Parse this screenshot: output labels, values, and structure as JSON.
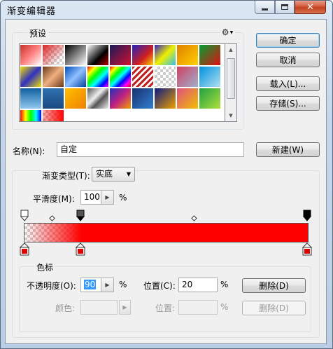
{
  "window": {
    "title": "渐变编辑器"
  },
  "titlebar_icons": {
    "minimize": "minimize-icon",
    "maximize": "maximize-icon",
    "close": "close-icon"
  },
  "buttons": {
    "ok": "确定",
    "cancel": "取消",
    "load": "载入(L)...",
    "save": "存储(S)...",
    "new": "新建(W)",
    "delete_opacity": "删除(D)",
    "delete_color": "删除(D)"
  },
  "presets": {
    "label": "预设",
    "menu_icon": "gear-icon"
  },
  "name": {
    "label": "名称(N):",
    "value": "自定"
  },
  "gradient_type": {
    "label": "渐变类型(T):",
    "value": "实底"
  },
  "smoothness": {
    "label": "平滑度(M):",
    "value": "100",
    "unit": "%"
  },
  "color_stops": {
    "group_label": "色标",
    "opacity_label": "不透明度(O):",
    "opacity_value": "90",
    "opacity_unit": "%",
    "location_label": "位置(C):",
    "location_value": "20",
    "location_unit": "%",
    "color_label": "颜色:",
    "color_location_label": "位置:",
    "color_location_unit": "%"
  },
  "gradient": {
    "color": "#ff0000",
    "opacity_stops": [
      0,
      20,
      100
    ],
    "color_stops": [
      0,
      20,
      100
    ]
  },
  "colors": {
    "accent": "#3399ff",
    "stop_color": "#ff0000",
    "selected_stop": "#000000"
  }
}
